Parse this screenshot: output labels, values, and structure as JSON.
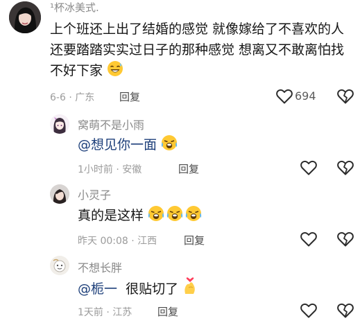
{
  "comments": [
    {
      "username": "¹杯冰美式.",
      "text": "上个班还上出了结婚的感觉 就像嫁给了不喜欢的人 还要踏踏实实过日子的那种感觉 想离又不敢离怕找不好下家",
      "meta": "6-6 · 广东",
      "reply": "回复",
      "likes": "694"
    },
    {
      "username": "窝萌不是小雨",
      "mention": "@想见你一面",
      "text": "",
      "meta": "1小时前 · 安徽",
      "reply": "回复"
    },
    {
      "username": "小灵子",
      "text": "真的是这样",
      "meta": "昨天 00:08 · 江西",
      "reply": "回复"
    },
    {
      "username": "不想长胖",
      "mention": "@栀一",
      "text": "很贴切了",
      "meta": "1天前 · 江苏",
      "reply": "回复"
    }
  ],
  "icons": {
    "like": "heart-outline-icon",
    "dislike": "broken-heart-icon",
    "laugh_emoji": "grinning-sweat-emoji",
    "cry_laugh_emoji": "crying-laughing-emoji",
    "love_emoji": "finger-heart-emoji"
  },
  "colors": {
    "username": "#8a8a8a",
    "mention": "#1d3f7a",
    "meta": "#9b9b9b"
  }
}
